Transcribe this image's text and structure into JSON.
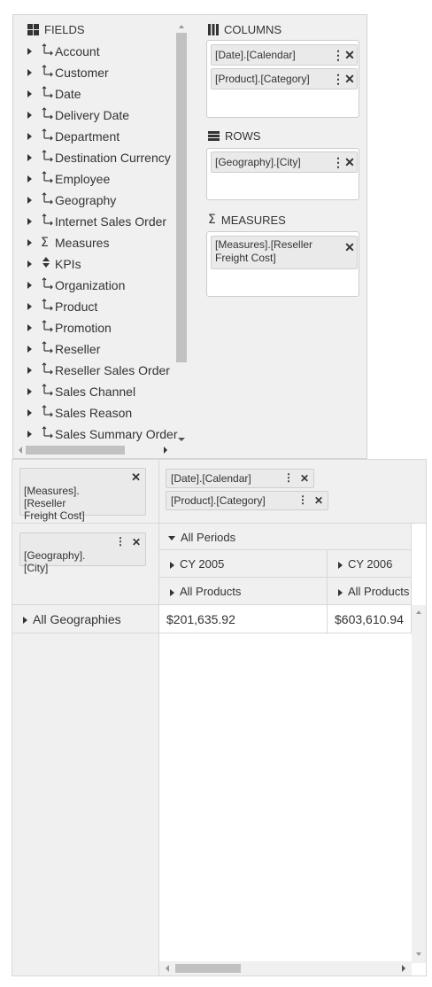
{
  "fieldlist": {
    "fields_title": "FIELDS",
    "columns_title": "COLUMNS",
    "rows_title": "ROWS",
    "measures_title": "MEASURES",
    "fields": [
      {
        "label": "Account",
        "icon": "hierarchy-icon"
      },
      {
        "label": "Customer",
        "icon": "hierarchy-icon"
      },
      {
        "label": "Date",
        "icon": "hierarchy-icon"
      },
      {
        "label": "Delivery Date",
        "icon": "hierarchy-icon"
      },
      {
        "label": "Department",
        "icon": "hierarchy-icon"
      },
      {
        "label": "Destination Currency",
        "icon": "hierarchy-icon"
      },
      {
        "label": "Employee",
        "icon": "hierarchy-icon"
      },
      {
        "label": "Geography",
        "icon": "hierarchy-icon"
      },
      {
        "label": "Internet Sales Order",
        "icon": "hierarchy-icon"
      },
      {
        "label": "Measures",
        "icon": "sigma-icon"
      },
      {
        "label": "KPIs",
        "icon": "kpi-icon"
      },
      {
        "label": "Organization",
        "icon": "hierarchy-icon"
      },
      {
        "label": "Product",
        "icon": "hierarchy-icon"
      },
      {
        "label": "Promotion",
        "icon": "hierarchy-icon"
      },
      {
        "label": "Reseller",
        "icon": "hierarchy-icon"
      },
      {
        "label": "Reseller Sales Order",
        "icon": "hierarchy-icon"
      },
      {
        "label": "Sales Channel",
        "icon": "hierarchy-icon"
      },
      {
        "label": "Sales Reason",
        "icon": "hierarchy-icon"
      },
      {
        "label": "Sales Summary Order",
        "icon": "hierarchy-icon"
      }
    ],
    "columns": [
      "[Date].[Calendar]",
      "[Product].[Category]"
    ],
    "rows": [
      "[Geography].[City]"
    ],
    "measures": [
      "[Measures].[Reseller Freight Cost]"
    ]
  },
  "grid": {
    "measure_chip": "[Measures].\n[Reseller\nFreight Cost]",
    "column_chips": [
      "[Date].[Calendar]",
      "[Product].[Category]"
    ],
    "row_chip": "[Geography].\n[City]",
    "all_periods": "All Periods",
    "years": [
      "CY 2005",
      "CY 2006"
    ],
    "all_products": "All Products",
    "row_header": "All Geographies",
    "values": [
      "$201,635.92",
      "$603,610.94"
    ]
  },
  "icons": {
    "close": "close-icon",
    "menu": "kebab-menu-icon"
  }
}
